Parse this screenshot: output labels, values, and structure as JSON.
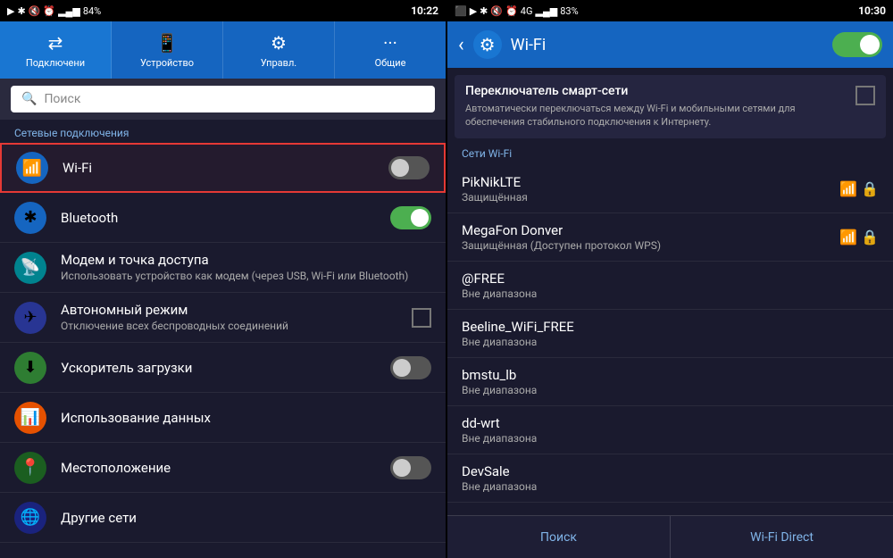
{
  "left": {
    "status_bar": {
      "play_icon": "▶",
      "bt_icon": "✱",
      "mute_icon": "🔇",
      "alarm_icon": "⏰",
      "signal_bars": "▂▄▆",
      "battery_pct": "84%",
      "time": "10:22"
    },
    "tabs": [
      {
        "id": "connections",
        "label": "Подключени",
        "icon": "⇄"
      },
      {
        "id": "device",
        "label": "Устройство",
        "icon": "📱"
      },
      {
        "id": "controls",
        "label": "Управл.",
        "icon": "⚙"
      },
      {
        "id": "general",
        "label": "Общие",
        "icon": "···"
      }
    ],
    "search_placeholder": "Поиск",
    "section_label": "Сетевые подключения",
    "items": [
      {
        "id": "wifi",
        "icon": "📶",
        "icon_class": "icon-blue",
        "title": "Wi-Fi",
        "subtitle": "",
        "toggle": "off",
        "highlighted": true
      },
      {
        "id": "bluetooth",
        "icon": "✱",
        "icon_class": "icon-blue",
        "title": "Bluetooth",
        "subtitle": "",
        "toggle": "on",
        "highlighted": false
      },
      {
        "id": "tethering",
        "icon": "📡",
        "icon_class": "icon-teal",
        "title": "Модем и точка доступа",
        "subtitle": "Использовать устройство как модем (через USB, Wi-Fi или Bluetooth)",
        "toggle": null,
        "highlighted": false
      },
      {
        "id": "airplane",
        "icon": "✈",
        "icon_class": "icon-indigo",
        "title": "Автономный режим",
        "subtitle": "Отключение всех беспроводных соединений",
        "toggle": "checkbox",
        "highlighted": false
      },
      {
        "id": "download_booster",
        "icon": "⬇",
        "icon_class": "icon-green",
        "title": "Ускоритель загрузки",
        "subtitle": "",
        "toggle": "off",
        "highlighted": false
      },
      {
        "id": "data_usage",
        "icon": "📊",
        "icon_class": "icon-orange",
        "title": "Использование данных",
        "subtitle": "",
        "toggle": null,
        "highlighted": false
      },
      {
        "id": "location",
        "icon": "📍",
        "icon_class": "icon-green2",
        "title": "Местоположение",
        "subtitle": "",
        "toggle": "off",
        "highlighted": false
      },
      {
        "id": "other_networks",
        "icon": "🌐",
        "icon_class": "icon-navy",
        "title": "Другие сети",
        "subtitle": "",
        "toggle": null,
        "highlighted": false
      }
    ]
  },
  "right": {
    "status_bar": {
      "screenshot_icon": "⬛",
      "play_icon": "▶",
      "bt_icon": "✱",
      "mute_icon": "🔇",
      "alarm_icon": "⏰",
      "network_type": "4G",
      "signal_bars": "▂▄▆",
      "battery_pct": "83%",
      "time": "10:30"
    },
    "header": {
      "back_icon": "‹",
      "settings_icon": "⚙",
      "title": "Wi-Fi"
    },
    "smart_switch": {
      "title": "Переключатель смарт-сети",
      "description": "Автоматически переключаться между Wi-Fi и мобильными сетями для обеспечения стабильного подключения к Интернету."
    },
    "wifi_section_label": "Сети Wi-Fi",
    "networks": [
      {
        "id": "piknik",
        "name": "PikNikLTE",
        "status": "Защищённая",
        "signal": "strong",
        "locked": true
      },
      {
        "id": "megafon",
        "name": "MegaFon Donver",
        "status": "Защищённая (Доступен протокол WPS)",
        "signal": "medium",
        "locked": true
      },
      {
        "id": "free",
        "name": "@FREE",
        "status": "Вне диапазона",
        "signal": "none",
        "locked": false
      },
      {
        "id": "beeline",
        "name": "Beeline_WiFi_FREE",
        "status": "Вне диапазона",
        "signal": "none",
        "locked": false
      },
      {
        "id": "bmstu",
        "name": "bmstu_lb",
        "status": "Вне диапазона",
        "signal": "none",
        "locked": false
      },
      {
        "id": "ddwrt",
        "name": "dd-wrt",
        "status": "Вне диапазона",
        "signal": "none",
        "locked": false
      },
      {
        "id": "devsale",
        "name": "DevSale",
        "status": "Вне диапазона",
        "signal": "none",
        "locked": false
      }
    ],
    "bottom_buttons": [
      {
        "id": "search",
        "label": "Поиск"
      },
      {
        "id": "wifi_direct",
        "label": "Wi-Fi Direct"
      }
    ]
  }
}
